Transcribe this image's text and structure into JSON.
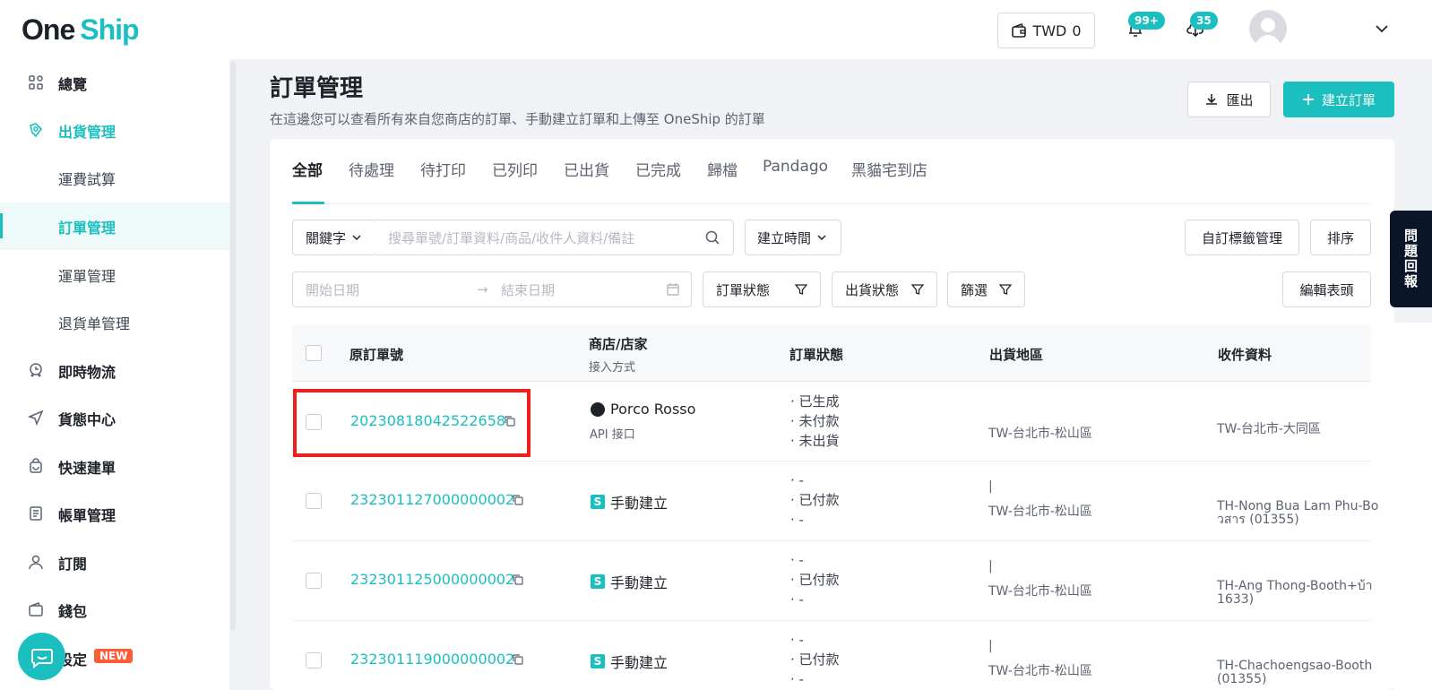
{
  "brand": {
    "part1": "One",
    "part2": "Ship"
  },
  "header": {
    "wallet_currency": "TWD",
    "wallet_amount": "0",
    "notification_count": "99+",
    "download_count": "35"
  },
  "sidebar": {
    "items": [
      {
        "label": "總覽",
        "icon": "dashboard-icon"
      },
      {
        "label": "出貨管理",
        "icon": "shipping-icon"
      },
      {
        "label": "運費試算"
      },
      {
        "label": "訂單管理"
      },
      {
        "label": "運單管理"
      },
      {
        "label": "退貨单管理"
      },
      {
        "label": "即時物流",
        "icon": "realtime-logistics-icon"
      },
      {
        "label": "貨態中心",
        "icon": "tracking-icon"
      },
      {
        "label": "快速建單",
        "icon": "quick-order-icon"
      },
      {
        "label": "帳單管理",
        "icon": "billing-icon"
      },
      {
        "label": "訂閱",
        "icon": "subscription-icon"
      },
      {
        "label": "錢包",
        "icon": "wallet-icon"
      },
      {
        "label": "設定",
        "icon": "settings-icon"
      }
    ],
    "new_badge": "NEW"
  },
  "page": {
    "title": "訂單管理",
    "subtitle": "在這邊您可以查看所有來自您商店的訂單、手動建立訂單和上傳至 OneShip 的訂單",
    "export_label": "匯出",
    "create_label": "建立訂單"
  },
  "tabs": [
    "全部",
    "待處理",
    "待打印",
    "已列印",
    "已出貨",
    "已完成",
    "歸檔",
    "Pandago",
    "黑貓宅到店"
  ],
  "filters": {
    "keyword_select": "關鍵字",
    "search_placeholder": "搜尋單號/訂單資料/商品/收件人資料/備註",
    "time_select": "建立時間",
    "custom_tag_button": "自訂標籤管理",
    "sort_button": "排序",
    "start_date_placeholder": "開始日期",
    "end_date_placeholder": "結束日期",
    "order_status": "訂單狀態",
    "shipping_status": "出貨狀態",
    "filter": "篩選",
    "edit_header_button": "編輯表頭"
  },
  "table": {
    "headers": {
      "order_no": "原訂單號",
      "store": "商店/店家",
      "store_sub": "接入方式",
      "order_status": "訂單狀態",
      "ship_region": "出貨地區",
      "recipient": "收件資料"
    },
    "rows": [
      {
        "order_no": "20230818042522658",
        "store": "Porco Rosso",
        "store_type": "circle",
        "store_sub": "API 接口",
        "status": [
          "已生成",
          "未付款",
          "未出貨"
        ],
        "region_mark": "",
        "region": "TW-台北市-松山區",
        "recipient": [
          "TW-台北市-大同區"
        ]
      },
      {
        "order_no": "232301127000000002",
        "store": "手動建立",
        "store_type": "s",
        "store_sub": "",
        "status": [
          "-",
          "已付款",
          "-"
        ],
        "region_mark": "|",
        "region": "TW-台北市-松山區",
        "recipient": [
          "TH-Nong Bua Lam Phu-Bo",
          "วสาร (01355)"
        ]
      },
      {
        "order_no": "232301125000000002",
        "store": "手動建立",
        "store_type": "s",
        "store_sub": "",
        "status": [
          "-",
          "已付款",
          "-"
        ],
        "region_mark": "|",
        "region": "TW-台北市-松山區",
        "recipient": [
          "TH-Ang Thong-Booth+บ้า",
          "1633)"
        ]
      },
      {
        "order_no": "232301119000000002",
        "store": "手動建立",
        "store_type": "s",
        "store_sub": "",
        "status": [
          "-",
          "已付款",
          "-"
        ],
        "region_mark": "|",
        "region": "TW-台北市-松山區",
        "recipient": [
          "TH-Chachoengsao-Booth",
          "(01355)"
        ]
      }
    ]
  },
  "feedback_tab": "問題回報",
  "colors": {
    "accent": "#1cbfbf",
    "highlight": "#f21d1d",
    "new_badge": "#ff5c3a"
  }
}
